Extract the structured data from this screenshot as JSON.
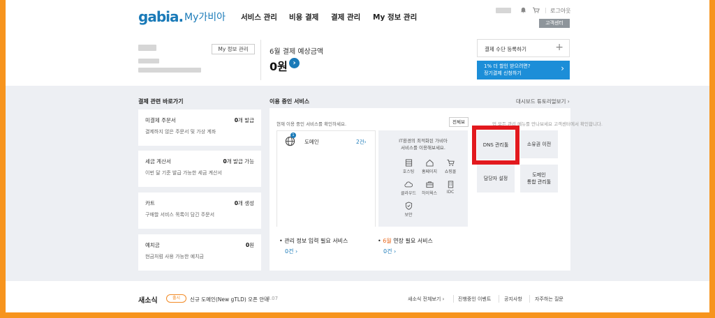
{
  "header": {
    "logo": "gabia.",
    "logo_sub": "My가비아",
    "nav": [
      "서비스 관리",
      "비용 결제",
      "결제 관리",
      "My 정보 관리"
    ],
    "logout": "로그아웃",
    "customer_center": "고객센터"
  },
  "summary": {
    "mypage_button": "My 정보 관리",
    "month_label": "6월 결제 예상금액",
    "amount": "0원",
    "go_icon": "chevron-right-icon",
    "payment_register": "결제 수단 등록하기",
    "promo_line1": "1% 더 할인 받으려면?",
    "promo_line2": "정기결제 신청하기"
  },
  "shortcuts": {
    "title": "결제 관련 바로가기",
    "cards": [
      {
        "title": "미결제 주문서",
        "count": "0",
        "unit": "개 발급",
        "desc": "결제하지 않은 주문서 및 가상 계좌"
      },
      {
        "title": "세금 계산서",
        "count": "0",
        "unit": "개 발급 가능",
        "desc": "이번 달 기준 발급 가능한 세금 계산서"
      },
      {
        "title": "카트",
        "count": "0",
        "unit": "개 생성",
        "desc": "구매할 서비스 목록이 담긴 주문서"
      },
      {
        "title": "예치금",
        "count": "0",
        "unit": "원",
        "desc": "현금처럼 사용 가능한 예치금"
      }
    ]
  },
  "services": {
    "title": "이용 중인 서비스",
    "dashboard_link": "대시보드 튜토리얼보기 ›",
    "hint": "현재 이용 중인 서비스를 확인하세요.",
    "all_button": "전체보",
    "behind_text": "업 모든 관리 메뉴를 만나보세요 고객센터에서 확인합니다.",
    "domain_badge": "1",
    "domain_label": "도메인",
    "domain_count": "2건›",
    "promo_line1": "IT환경의 최적화된 가비아",
    "promo_line2": "서비스를 이용해보세요.",
    "promo_items": [
      {
        "label": "호스팅",
        "icon": "server-icon"
      },
      {
        "label": "홈페이지",
        "icon": "home-icon"
      },
      {
        "label": "쇼핑몰",
        "icon": "cart-icon"
      },
      {
        "label": "클라우드",
        "icon": "cloud-icon"
      },
      {
        "label": "하이웍스",
        "icon": "briefcase-icon"
      },
      {
        "label": "IDC",
        "icon": "building-icon"
      },
      {
        "label": "보안",
        "icon": "shield-icon"
      }
    ],
    "tiles": {
      "dns": "DNS 관리툴",
      "owner_transfer": "소유권 이전",
      "manager_setting": "담당자 설정",
      "domain_integrated_line1": "도메인",
      "domain_integrated_line2": "통합 관리툴"
    },
    "pending": {
      "title": "관리 정보 입력 필요 서비스",
      "count": "0건 ›"
    },
    "renewal": {
      "month": "6월",
      "title": " 연장 필요 서비스",
      "count": "0건 ›"
    }
  },
  "news": {
    "title": "새소식",
    "badge": "출시",
    "text": "신규 도메인(New gTLD) 오픈 안내",
    "date": "03.07",
    "links": [
      "새소식 전체보기 ›",
      "진행중인 이벤트",
      "공지사항",
      "자주하는 질문"
    ]
  },
  "colors": {
    "brand": "#1a7ab8",
    "highlight": "#e2191e",
    "frame": "#f7941d",
    "promo_bg": "#1c8ed8"
  }
}
